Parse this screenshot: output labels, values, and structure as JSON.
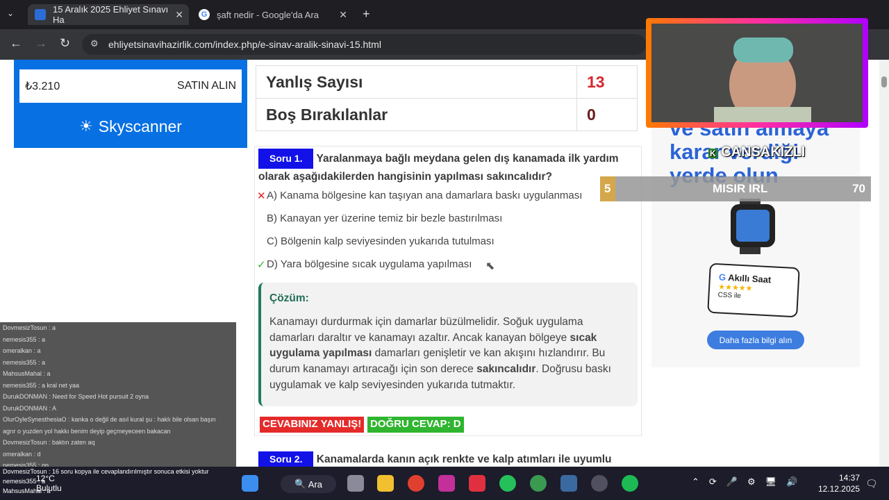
{
  "browser": {
    "tabs": [
      {
        "title": "15 Aralık 2025 Ehliyet Sınavı Ha",
        "active": true
      },
      {
        "title": "şaft nedir - Google'da Ara",
        "active": false
      }
    ],
    "url": "ehliyetsinavihazirlik.com/index.php/e-sinav-aralik-sinavi-15.html"
  },
  "left_ad": {
    "price": "₺3.210",
    "cta": "SATIN ALIN",
    "brand": "Skyscanner"
  },
  "stats": [
    {
      "label": "Yanlış Sayısı",
      "value": "13"
    },
    {
      "label": "Boş Bırakılanlar",
      "value": "0"
    }
  ],
  "question1": {
    "tag": "Soru 1.",
    "text_line1": "Yaralanmaya bağlı meydana gelen dış kanamada ilk yardım",
    "text_line2": "olarak aşağıdakilerden hangisinin yapılması sakıncalıdır?",
    "options": [
      "A) Kanama bölgesine kan taşıyan ana damarlara baskı uygulanması",
      "B) Kanayan yer üzerine temiz bir bezle bastırılması",
      "C) Bölgenin kalp seviyesinden yukarıda tutulması",
      "D) Yara bölgesine sıcak uygulama yapılması"
    ],
    "wrong_mark": "✕",
    "right_mark": "✓",
    "solution_heading": "Çözüm:",
    "solution_p1": "Kanamayı durdurmak için damarlar büzülmelidir. Soğuk uygulama damarları daraltır ve kanamayı azaltır. Ancak kanayan bölgeye ",
    "solution_b1": "sıcak uygulama yapılması",
    "solution_p2": " damarları genişletir ve kan akışını hızlandırır. Bu durum kanamayı artıracağı için son derece ",
    "solution_b2": "sakıncalıdır",
    "solution_p3": ". Doğrusu baskı uygulamak ve kalp seviyesinden yukarıda tutmaktır.",
    "verdict": "CEVABINIZ YANLIŞ!",
    "correct": "DOĞRU CEVAP: D"
  },
  "question2": {
    "tag": "Soru 2.",
    "text": "Kanamalarda kanın açık renkte ve kalp atımları ile uyumlu"
  },
  "right_ad": {
    "headline": "ve satın almaya karar verdiği yerde olun",
    "card_title": "Akıllı Saat",
    "card_sub": "CSS ile",
    "stars": "★★★★★",
    "button": "Daha fazla bilgi alın"
  },
  "stream": {
    "name": "CANSAKIZLI",
    "goal_left": "5",
    "goal_title": "MISIR IRL",
    "goal_right": "70"
  },
  "chat": [
    "DovmesizTosun : a",
    "nemesis355 : a",
    "omeralkan : a",
    "nemesis355 : a",
    "MahsusMahal : a",
    "nemesis355 : a kral net yaa",
    "DurukDONMAN : Need for Speed Hot pursuit 2 oyna",
    "DurukDONMAN : A",
    "OlurOyleSynesthesiaO : kanka o değil de asıl kural şu : haklı bile olsan başın",
    "agrır o yuzden yol hakkı benim deyip geçmeyeceen bakacan",
    "DovmesizTosun : baktın zaten aq",
    "omeralkan : d",
    "nemesis355 : on",
    "DovmesizTosun : 16 soru kopya ile cevaplandırılmıştır sonuca etkisi yoktur",
    "nemesis355 : a",
    "MahsusMahal : a"
  ],
  "taskbar": {
    "weather_temp": "12°C",
    "weather_desc": "Bulutlu",
    "search": "Ara",
    "time": "14:37",
    "date": "12.12.2025"
  },
  "colors": {
    "accent_blue": "#1212e8",
    "wrong_red": "#d9262e",
    "correct_green": "#2fb52f",
    "solution_green": "#1f6e56"
  }
}
